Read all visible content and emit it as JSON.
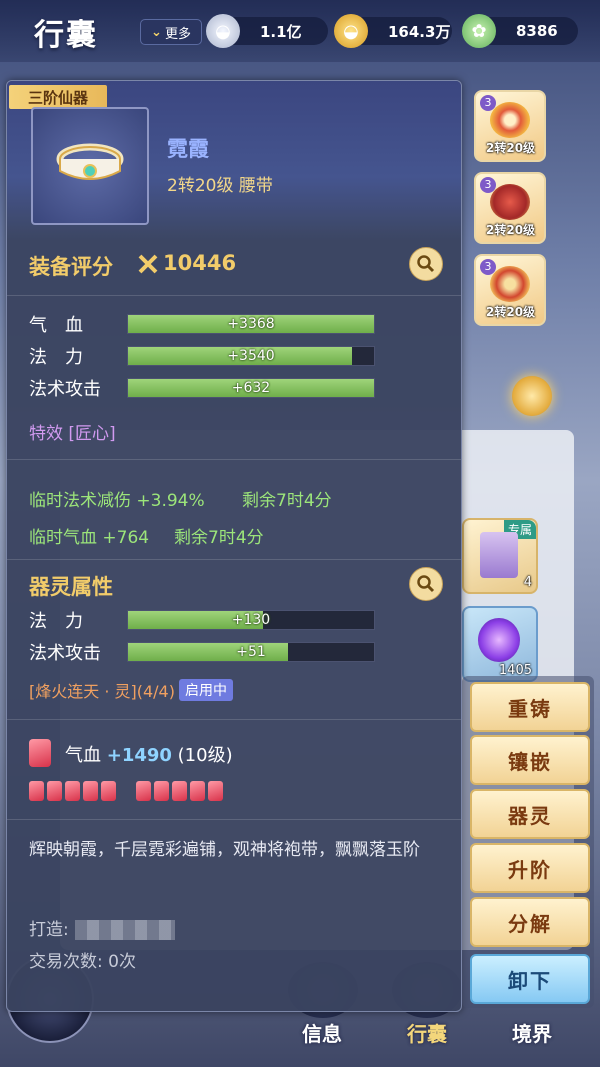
{
  "header": {
    "title": "行囊",
    "more_label": "更多",
    "currencies": [
      {
        "icon": "silver-ingot-icon",
        "value": "1.1亿"
      },
      {
        "icon": "gold-ingot-icon",
        "value": "164.3万"
      },
      {
        "icon": "jade-coin-icon",
        "value": "8386"
      }
    ]
  },
  "equipped_slots": [
    {
      "level": "3",
      "label": "2转20级"
    },
    {
      "level": "3",
      "label": "2转20级"
    },
    {
      "level": "3",
      "label": "2转20级"
    }
  ],
  "bag_items": [
    {
      "badge": "专属",
      "count": "4"
    },
    {
      "badge": "",
      "count": "1405"
    }
  ],
  "item": {
    "grade": "三阶仙器",
    "name": "霓霞",
    "subtitle": "2转20级 腰带",
    "score_label": "装备评分",
    "score": "10446",
    "stats": [
      {
        "name": "气　血",
        "value": "+3368",
        "fill": 1.0
      },
      {
        "name": "法　力",
        "value": "+3540",
        "fill": 0.91
      },
      {
        "name": "法术攻击",
        "value": "+632",
        "fill": 1.0
      }
    ],
    "effect": "特效 [匠心]",
    "temp_buffs": [
      {
        "text": "临时法术减伤 +3.94%",
        "remain": "剩余7时4分"
      },
      {
        "text": "临时气血 +764",
        "remain": "剩余7时4分"
      }
    ],
    "spirit_title": "器灵属性",
    "spirit_stats": [
      {
        "name": "法　力",
        "value": "+130",
        "fill": 0.55
      },
      {
        "name": "法术攻击",
        "value": "+51",
        "fill": 0.65
      }
    ],
    "set_name": "[烽火连天 · 灵](4/4)",
    "set_status": "启用中",
    "gem_name": "气血",
    "gem_value": "+1490",
    "gem_level": "(10级)",
    "gem_count": 10,
    "description": "辉映朝霞，千层霓彩遍铺，观神将袍带，飘飘落玉阶",
    "forge_label": "打造:",
    "trade_label": "交易次数: 0次"
  },
  "actions": [
    "重铸",
    "镶嵌",
    "器灵",
    "升阶",
    "分解",
    "卸下"
  ],
  "bottom_nav": [
    {
      "label": "信息",
      "active": false
    },
    {
      "label": "行囊",
      "active": true
    },
    {
      "label": "境界",
      "active": false
    }
  ]
}
